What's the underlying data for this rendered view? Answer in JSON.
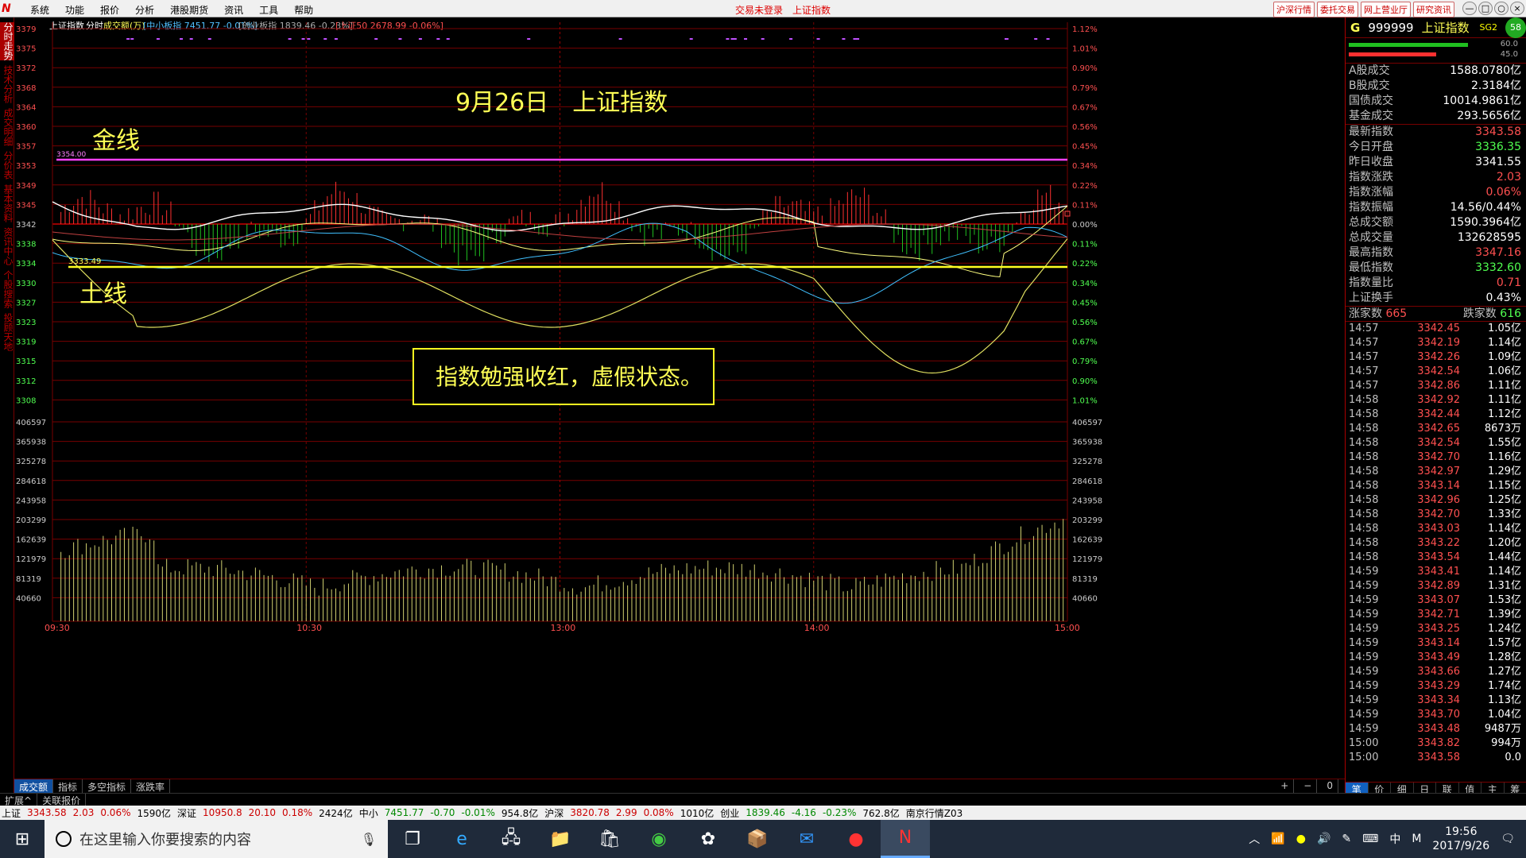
{
  "menubar": {
    "items": [
      "系统",
      "功能",
      "报价",
      "分析",
      "港股期货",
      "资讯",
      "工具",
      "帮助"
    ],
    "center": [
      "交易未登录",
      "上证指数"
    ],
    "right_links": [
      "沪深行情",
      "委托交易",
      "网上营业厅",
      "研究资讯"
    ],
    "win_buttons": [
      "—",
      "□",
      "○",
      "×"
    ]
  },
  "leftbar": {
    "items": [
      "分时走势",
      "技术分析",
      "成交明细",
      "分价表",
      "基本资料",
      "资讯中心",
      "个股搜索",
      "投顾天地"
    ]
  },
  "chart": {
    "header": {
      "name": "上证指数",
      "mode": "分时",
      "volunit": "成交额(万)",
      "zxb": "[中小板指 7451.77 -0.01%]",
      "cyb": "[创业板指 1839.46 -0.23%]",
      "sz50": "[上证50 2678.99 -0.06%]"
    },
    "price_labels": [
      "3379",
      "3375",
      "3372",
      "3368",
      "3364",
      "3360",
      "3357",
      "3353",
      "3349",
      "3345",
      "3342",
      "3338",
      "3334",
      "3330",
      "3327",
      "3323",
      "3319",
      "3315",
      "3312",
      "3308"
    ],
    "pct_labels": [
      "1.12%",
      "1.01%",
      "0.90%",
      "0.79%",
      "0.67%",
      "0.56%",
      "0.45%",
      "0.34%",
      "0.22%",
      "0.11%",
      "0.00%",
      "0.11%",
      "0.22%",
      "0.34%",
      "0.45%",
      "0.56%",
      "0.67%",
      "0.79%",
      "0.90%",
      "1.01%"
    ],
    "vol_labels": [
      "406597",
      "365938",
      "325278",
      "284618",
      "243958",
      "203299",
      "162639",
      "121979",
      "81319",
      "40660"
    ],
    "time_labels": [
      "09:30",
      "10:30",
      "13:00",
      "14:00",
      "15:00"
    ],
    "annotations": {
      "title": "9月26日　上证指数",
      "gold_label": "金线",
      "gold_value": "3354.00",
      "earth_label": "土线",
      "earth_value": "3333.49",
      "box_text": "指数勉强收红，虚假状态。"
    }
  },
  "right": {
    "code_g": "G",
    "code": "999999",
    "name": "上证指数",
    "sig": "SG2",
    "badge": "58",
    "bar_vals": [
      "60.0",
      "45.0"
    ],
    "stats1": [
      {
        "k": "A股成交",
        "v": "1588.0780亿",
        "c": "wht"
      },
      {
        "k": "B股成交",
        "v": "2.3184亿",
        "c": "wht"
      },
      {
        "k": "国债成交",
        "v": "10014.9861亿",
        "c": "wht"
      },
      {
        "k": "基金成交",
        "v": "293.5656亿",
        "c": "wht"
      }
    ],
    "stats2": [
      {
        "k": "最新指数",
        "v": "3343.58",
        "c": "red"
      },
      {
        "k": "今日开盘",
        "v": "3336.35",
        "c": "grn"
      },
      {
        "k": "昨日收盘",
        "v": "3341.55",
        "c": "wht"
      },
      {
        "k": "指数涨跌",
        "v": "2.03",
        "c": "red"
      },
      {
        "k": "指数涨幅",
        "v": "0.06%",
        "c": "red"
      },
      {
        "k": "指数振幅",
        "v": "14.56/0.44%",
        "c": "wht"
      },
      {
        "k": "总成交额",
        "v": "1590.3964亿",
        "c": "wht"
      },
      {
        "k": "总成交量",
        "v": "132628595",
        "c": "wht"
      },
      {
        "k": "最高指数",
        "v": "3347.16",
        "c": "red"
      },
      {
        "k": "最低指数",
        "v": "3332.60",
        "c": "grn"
      },
      {
        "k": "指数量比",
        "v": "0.71",
        "c": "red"
      },
      {
        "k": "上证换手",
        "v": "0.43%",
        "c": "wht"
      }
    ],
    "updown": {
      "up_label": "涨家数",
      "up": "665",
      "down_label": "跌家数",
      "down": "616"
    },
    "ticks": [
      [
        "14:57",
        "3342.45",
        "1.05亿"
      ],
      [
        "14:57",
        "3342.19",
        "1.14亿"
      ],
      [
        "14:57",
        "3342.26",
        "1.09亿"
      ],
      [
        "14:57",
        "3342.54",
        "1.06亿"
      ],
      [
        "14:57",
        "3342.86",
        "1.11亿"
      ],
      [
        "14:58",
        "3342.92",
        "1.11亿"
      ],
      [
        "14:58",
        "3342.44",
        "1.12亿"
      ],
      [
        "14:58",
        "3342.65",
        "8673万"
      ],
      [
        "14:58",
        "3342.54",
        "1.55亿"
      ],
      [
        "14:58",
        "3342.70",
        "1.16亿"
      ],
      [
        "14:58",
        "3342.97",
        "1.29亿"
      ],
      [
        "14:58",
        "3343.14",
        "1.15亿"
      ],
      [
        "14:58",
        "3342.96",
        "1.25亿"
      ],
      [
        "14:58",
        "3342.70",
        "1.33亿"
      ],
      [
        "14:58",
        "3343.03",
        "1.14亿"
      ],
      [
        "14:58",
        "3343.22",
        "1.20亿"
      ],
      [
        "14:58",
        "3343.54",
        "1.44亿"
      ],
      [
        "14:59",
        "3343.41",
        "1.14亿"
      ],
      [
        "14:59",
        "3342.89",
        "1.31亿"
      ],
      [
        "14:59",
        "3343.07",
        "1.53亿"
      ],
      [
        "14:59",
        "3342.71",
        "1.39亿"
      ],
      [
        "14:59",
        "3343.25",
        "1.24亿"
      ],
      [
        "14:59",
        "3343.14",
        "1.57亿"
      ],
      [
        "14:59",
        "3343.49",
        "1.28亿"
      ],
      [
        "14:59",
        "3343.66",
        "1.27亿"
      ],
      [
        "14:59",
        "3343.29",
        "1.74亿"
      ],
      [
        "14:59",
        "3343.34",
        "1.13亿"
      ],
      [
        "14:59",
        "3343.70",
        "1.04亿"
      ],
      [
        "14:59",
        "3343.48",
        "9487万"
      ],
      [
        "15:00",
        "3343.82",
        "994万"
      ],
      [
        "15:00",
        "3343.58",
        "0.0"
      ]
    ],
    "tabs": [
      "笔",
      "价",
      "细",
      "日",
      "联",
      "值",
      "主",
      "筹"
    ]
  },
  "bottomtabs": {
    "items": [
      "成交额",
      "指标",
      "多空指标",
      "涨跌率"
    ],
    "ctl": [
      "+",
      "−",
      "0"
    ]
  },
  "subtabs": [
    "扩展^",
    "关联报价"
  ],
  "statusbar": {
    "items": [
      {
        "t": "上证",
        "c": ""
      },
      {
        "t": "3343.58",
        "c": "r"
      },
      {
        "t": "2.03",
        "c": "r"
      },
      {
        "t": "0.06%",
        "c": "r"
      },
      {
        "t": "1590亿",
        "c": ""
      },
      {
        "t": "深证",
        "c": ""
      },
      {
        "t": "10950.8",
        "c": "r"
      },
      {
        "t": "20.10",
        "c": "r"
      },
      {
        "t": "0.18%",
        "c": "r"
      },
      {
        "t": "2424亿",
        "c": ""
      },
      {
        "t": "中小",
        "c": ""
      },
      {
        "t": "7451.77",
        "c": "g"
      },
      {
        "t": "-0.70",
        "c": "g"
      },
      {
        "t": "-0.01%",
        "c": "g"
      },
      {
        "t": "954.8亿",
        "c": ""
      },
      {
        "t": "沪深",
        "c": ""
      },
      {
        "t": "3820.78",
        "c": "r"
      },
      {
        "t": "2.99",
        "c": "r"
      },
      {
        "t": "0.08%",
        "c": "r"
      },
      {
        "t": "1010亿",
        "c": ""
      },
      {
        "t": "创业",
        "c": ""
      },
      {
        "t": "1839.46",
        "c": "g"
      },
      {
        "t": "-4.16",
        "c": "g"
      },
      {
        "t": "-0.23%",
        "c": "g"
      },
      {
        "t": "762.8亿",
        "c": ""
      },
      {
        "t": "南京行情Z03",
        "c": ""
      }
    ]
  },
  "taskbar": {
    "search_placeholder": "在这里输入你要搜索的内容",
    "time": "19:56",
    "date": "2017/9/26",
    "ime": "中",
    "ime2": "M"
  }
}
